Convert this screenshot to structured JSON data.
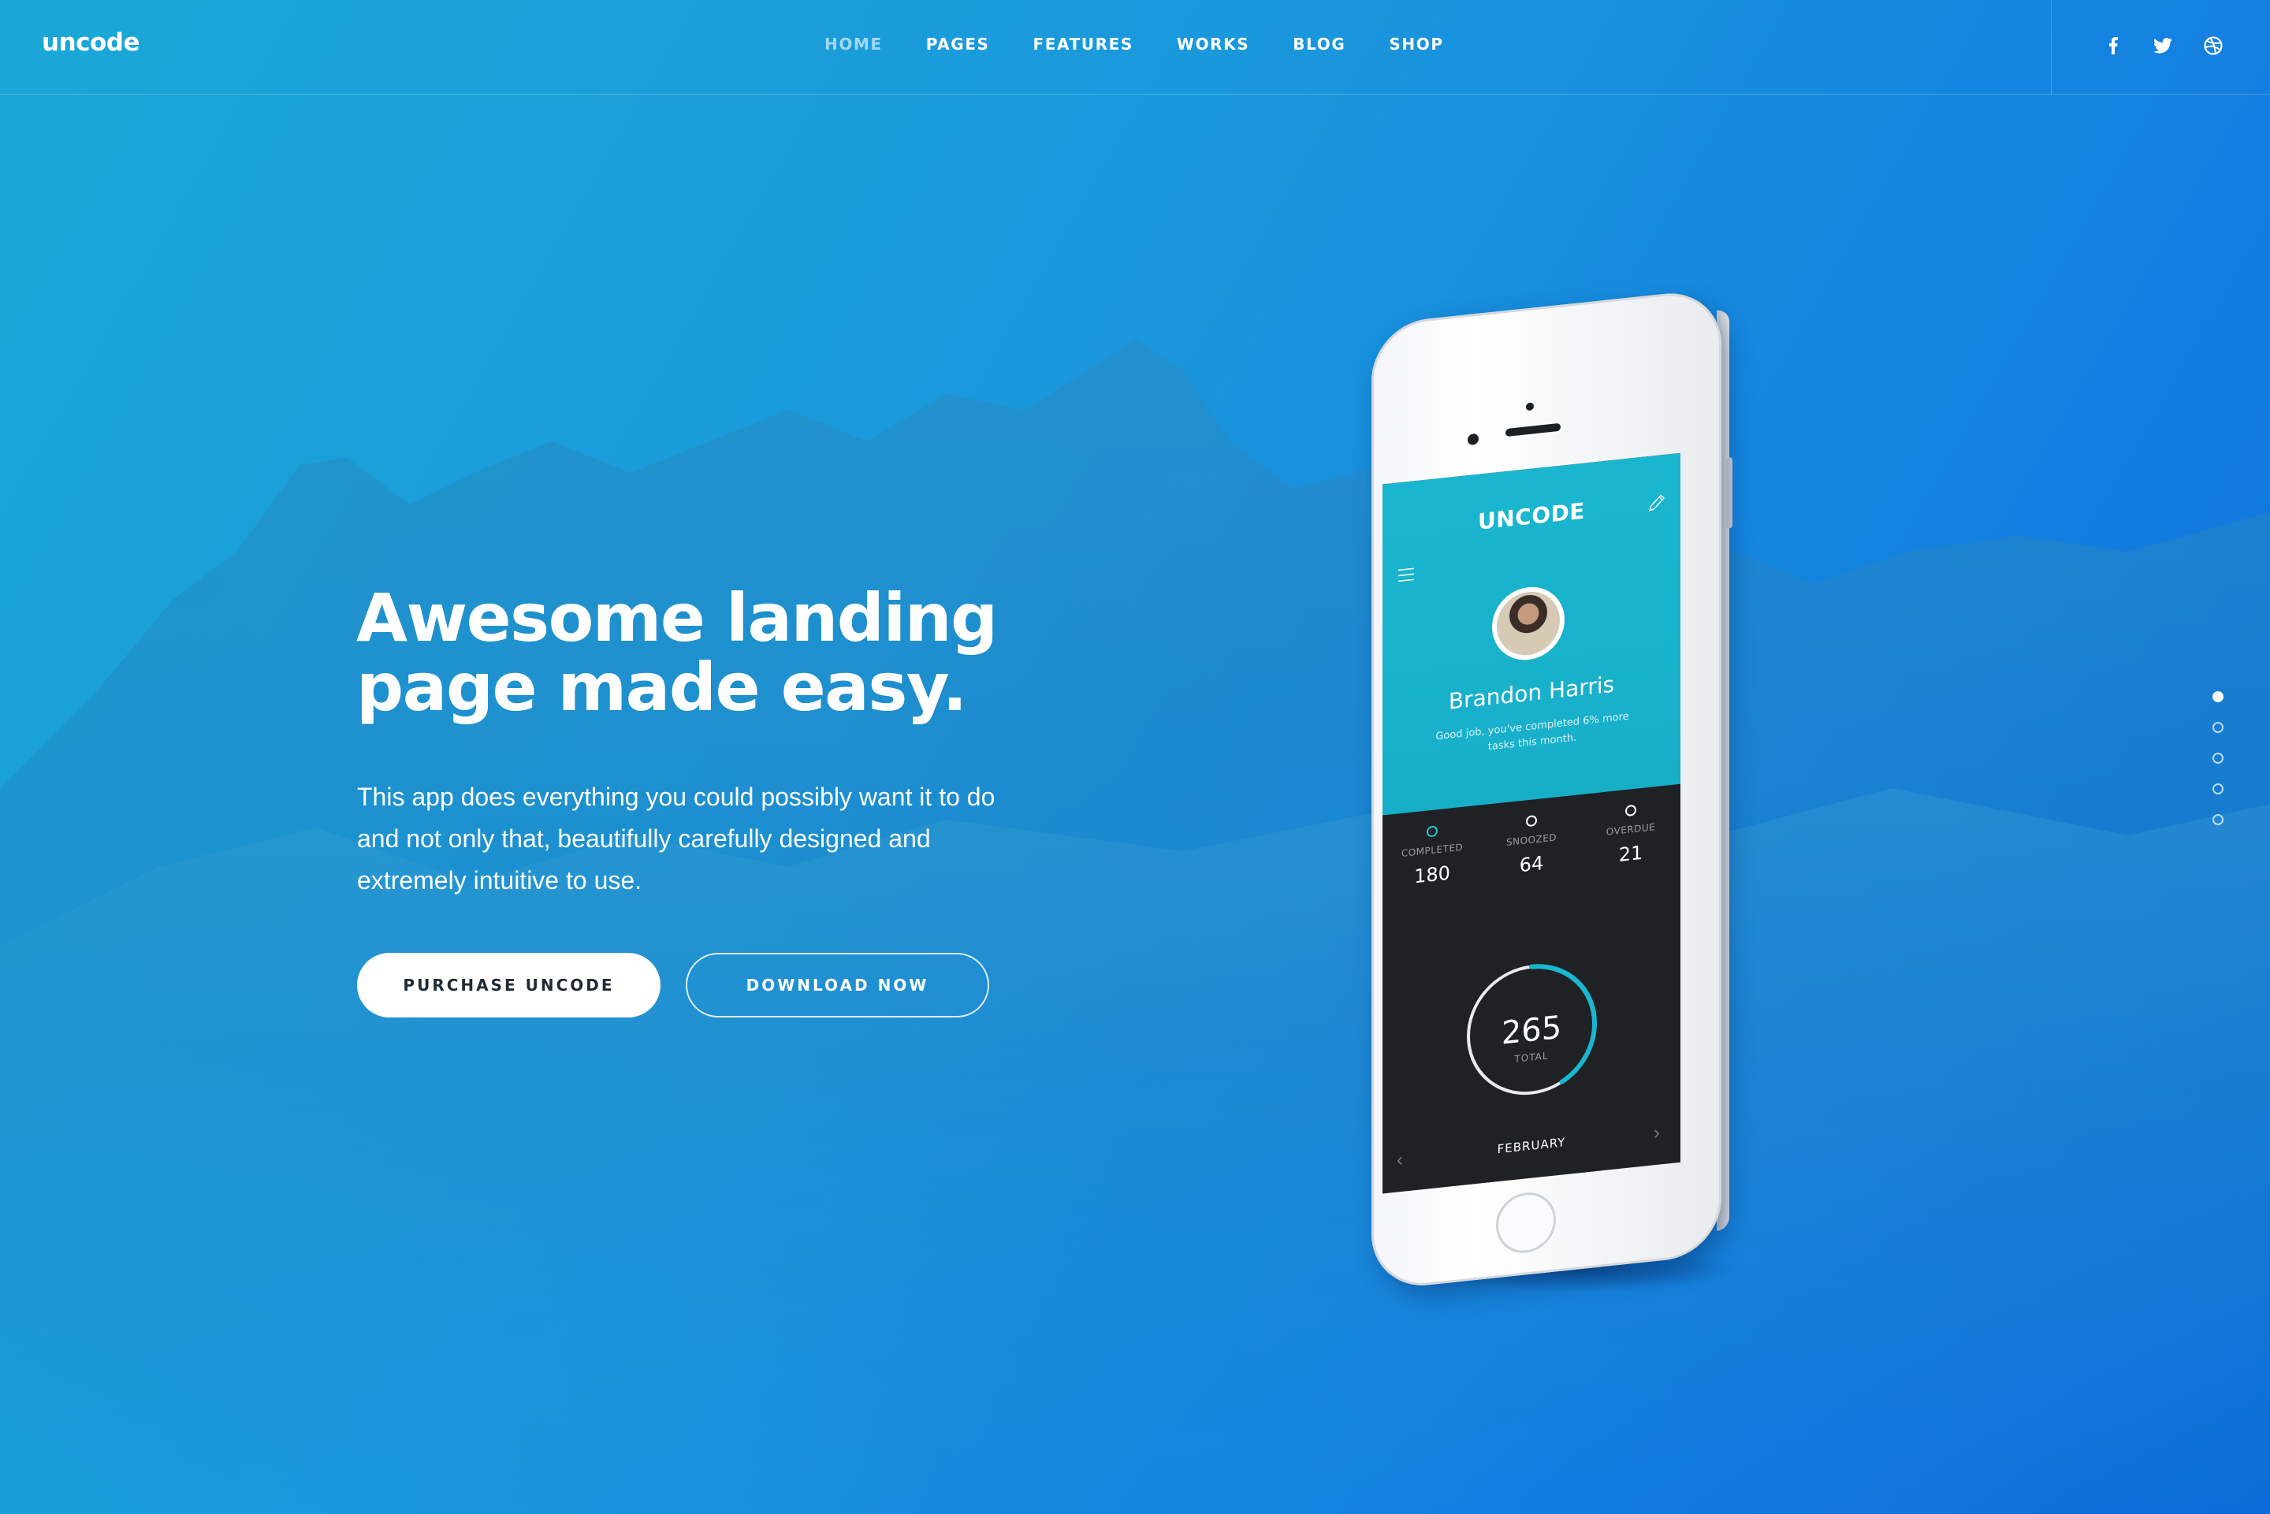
{
  "header": {
    "logo": "uncode",
    "nav": [
      {
        "label": "HOME",
        "active": true
      },
      {
        "label": "PAGES",
        "active": false
      },
      {
        "label": "FEATURES",
        "active": false
      },
      {
        "label": "WORKS",
        "active": false
      },
      {
        "label": "BLOG",
        "active": false
      },
      {
        "label": "SHOP",
        "active": false
      }
    ],
    "social_icons": [
      "facebook-icon",
      "twitter-icon",
      "dribbble-icon"
    ]
  },
  "hero": {
    "title_lines": [
      "Awesome landing",
      "page made easy."
    ],
    "description_lines": [
      "This app does everything you could possibly want it to do",
      "and not only that, beautifully carefully designed and",
      "extremely intuitive to use."
    ],
    "primary_button": "PURCHASE UNCODE",
    "secondary_button": "DOWNLOAD NOW"
  },
  "pagination": {
    "count": 5,
    "active_index": 0
  },
  "phone_app": {
    "title": "UNCODE",
    "user_name": "Brandon Harris",
    "message_lines": [
      "Good job, you've completed 6% more",
      "tasks this month."
    ],
    "stats": [
      {
        "label": "COMPLETED",
        "value": "180"
      },
      {
        "label": "SNOOZED",
        "value": "64"
      },
      {
        "label": "OVERDUE",
        "value": "21"
      }
    ],
    "total_value": "265",
    "total_label": "TOTAL",
    "month": "FEBRUARY",
    "progress_fraction": 0.42
  },
  "colors": {
    "accent": "#1ab6cf",
    "background_top": "#1aa7d6",
    "background_bottom": "#0c6cd8",
    "button_text": "#1f2a33"
  }
}
